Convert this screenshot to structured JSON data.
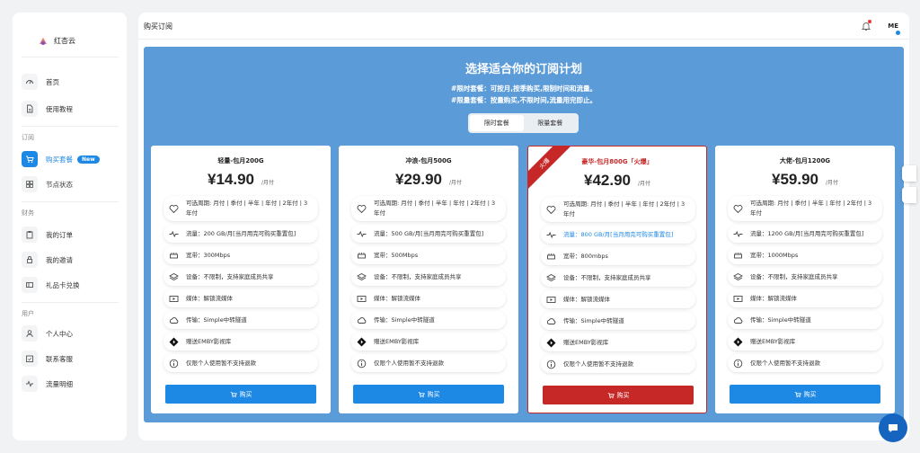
{
  "app": {
    "brand": "红杏云"
  },
  "sidebar": {
    "items": [
      {
        "label": "首页",
        "icon": "gauge-icon"
      },
      {
        "label": "使用教程",
        "icon": "document-icon"
      },
      {
        "label": "购买套餐",
        "icon": "cart-icon",
        "badge": "New",
        "active": true
      },
      {
        "label": "节点状态",
        "icon": "grid-icon"
      },
      {
        "label": "我的订单",
        "icon": "clipboard-icon"
      },
      {
        "label": "我的邀请",
        "icon": "lock-icon"
      },
      {
        "label": "礼品卡兑换",
        "icon": "card-icon"
      },
      {
        "label": "个人中心",
        "icon": "user-icon"
      },
      {
        "label": "联系客服",
        "icon": "calendar-icon"
      },
      {
        "label": "流量明细",
        "icon": "activity-icon"
      }
    ],
    "sections": {
      "subscribe": "订阅",
      "finance": "财务",
      "user": "用户"
    }
  },
  "header": {
    "title": "购买订阅",
    "user_initials": "ME"
  },
  "panel": {
    "headline": "选择适合你的订阅计划",
    "sub1": "#限时套餐：可按月,按季购买,限制时间和流量。",
    "sub2": "#限量套餐：按量购买,不限时间,流量用完即止。",
    "tabs": [
      "限时套餐",
      "限量套餐"
    ]
  },
  "plans": [
    {
      "name": "轻量-包月200G",
      "price": "¥14.90",
      "per": "/月付",
      "features": [
        "可选周期: 月付 | 季付 | 半年 | 年付 | 2年付 | 3年付",
        "流量：200 GB/月[当月用完可购买重置包]",
        "宽带：300Mbps",
        "设备：不限制，支持家庭成员共享",
        "媒体：解锁流媒体",
        "传输：Simple中转隧道",
        "赠送EMBY影视库",
        "仅限个人使用暂不支持退款"
      ],
      "buy": "购买"
    },
    {
      "name": "冲浪-包月500G",
      "price": "¥29.90",
      "per": "/月付",
      "features": [
        "可选周期: 月付 | 季付 | 半年 | 年付 | 2年付 | 3年付",
        "流量：500 GB/月[当月用完可购买重置包]",
        "宽带：500Mbps",
        "设备：不限制，支持家庭成员共享",
        "媒体：解锁流媒体",
        "传输：Simple中转隧道",
        "赠送EMBY影视库",
        "仅限个人使用暂不支持退款"
      ],
      "buy": "购买"
    },
    {
      "name": "豪华-包月800G「火爆」",
      "price": "¥42.90",
      "per": "/月付",
      "ribbon": "火爆",
      "features": [
        "可选周期: 月付 | 季付 | 半年 | 年付 | 2年付 | 3年付",
        "流量：800 GB/月[当月用完可购买重置包]",
        "宽带：800mbps",
        "设备：不限制，支持家庭成员共享",
        "媒体：解锁流媒体",
        "传输：Simple中转隧道",
        "赠送EMBY影视库",
        "仅限个人使用暂不支持退款"
      ],
      "buy": "购买"
    },
    {
      "name": "大佬-包月1200G",
      "price": "¥59.90",
      "per": "/月付",
      "features": [
        "可选周期: 月付 | 季付 | 半年 | 年付 | 2年付 | 3年付",
        "流量：1200 GB/月[当月用完可购买重置包]",
        "宽带：1000Mbps",
        "设备：不限制，支持家庭成员共享",
        "媒体：解锁流媒体",
        "传输：Simple中转隧道",
        "赠送EMBY影视库",
        "仅限个人使用暂不支持退款"
      ],
      "buy": "购买"
    }
  ],
  "colors": {
    "accent": "#1e88e5",
    "hot": "#c62828",
    "panel": "#5b9bd8"
  }
}
